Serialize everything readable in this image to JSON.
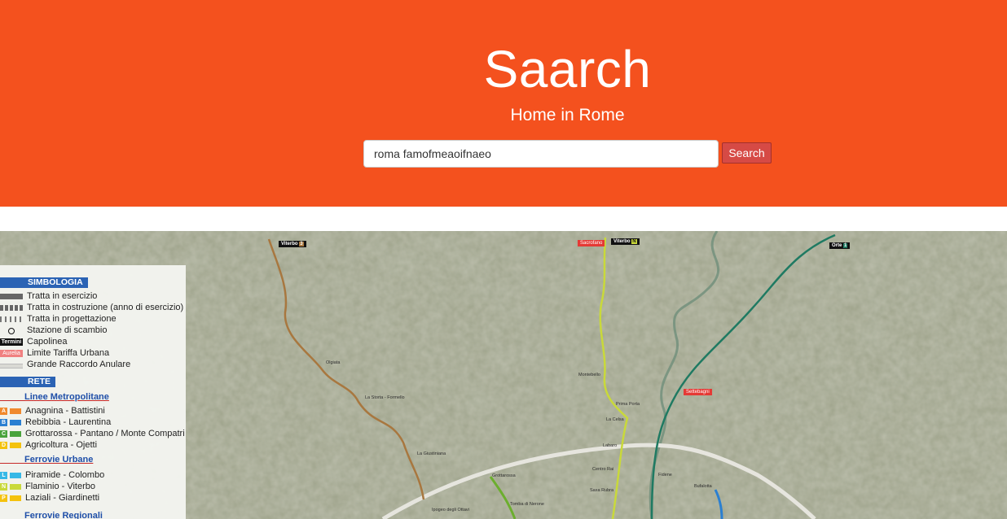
{
  "header": {
    "title": "Saarch",
    "subtitle": "Home in Rome",
    "background_color": "#f4511e"
  },
  "search": {
    "value": "roma famofmeaoifnaeo",
    "button_label": "Search",
    "button_color": "#d64a45"
  },
  "map": {
    "legend": {
      "simbologia_title": "SIMBOLOGIA",
      "simbologia_items": [
        "Tratta in esercizio",
        "Tratta in costruzione (anno di esercizio)",
        "Tratta in progettazione",
        "Stazione di scambio",
        "Capolinea",
        "Limite Tariffa Urbana",
        "Grande Raccordo Anulare"
      ],
      "capolinea_badge": "Termini",
      "limite_badge": "Aurelia",
      "rete_title": "RETE",
      "linee_metropolitane_heading": "Linee Metropolitane",
      "linee_metropolitane": [
        {
          "letter": "A",
          "label": "Anagnina - Battistini",
          "color": "#f0892e"
        },
        {
          "letter": "B",
          "label": "Rebibbia - Laurentina",
          "color": "#2b7fd1"
        },
        {
          "letter": "C",
          "label": "Grottarossa - Pantano / Monte Compatri",
          "color": "#49a33b"
        },
        {
          "letter": "D",
          "label": "Agricoltura - Ojetti",
          "color": "#f4c20d"
        }
      ],
      "ferrovie_urbane_heading": "Ferrovie Urbane",
      "ferrovie_urbane": [
        {
          "letter": "L",
          "label": "Piramide - Colombo",
          "color": "#36b8e6"
        },
        {
          "letter": "N",
          "label": "Flaminio - Viterbo",
          "color": "#c9d93a"
        },
        {
          "letter": "P",
          "label": "Laziali - Giardinetti",
          "color": "#f4c20d"
        }
      ],
      "ferrovie_regionali_heading": "Ferrovie Regionali"
    },
    "line_tags": [
      {
        "label": "Viterbo",
        "num": "3"
      },
      {
        "label": "Viterbo",
        "num": "N"
      },
      {
        "label": "Orte",
        "num": "1"
      }
    ],
    "red_tags": [
      "Sacrofano",
      "Settebagni"
    ],
    "places": [
      "Olgiata",
      "La Storta - Formello",
      "La Giustiniana",
      "Prima Porta",
      "Montebello",
      "La Celsa",
      "Labaro",
      "Centro Rai",
      "Saxa Rubra",
      "Grottarossa",
      "Tomba di Nerone",
      "Ipogeo degli Ottavi",
      "Fidene",
      "Bufalotta"
    ],
    "line_colors": {
      "fl3": "#a8773f",
      "roma_nord": "#c9d93a",
      "fl1": "#1f7a62",
      "metro_c": "#6cae2e",
      "metro_b": "#2b7fd1",
      "gra": "#d9d9d4"
    }
  }
}
